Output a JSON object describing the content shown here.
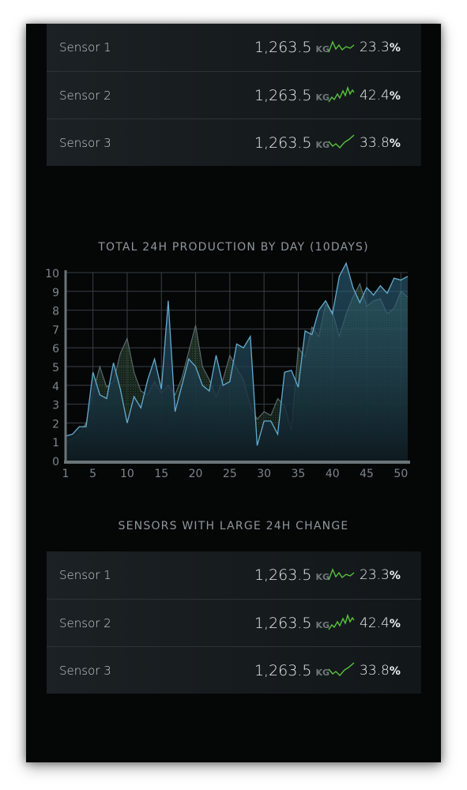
{
  "units": "KG",
  "top_sensors": [
    {
      "name": "Sensor 1",
      "value": "1,263.5",
      "pct": "23.3",
      "trend": "volatile"
    },
    {
      "name": "Sensor 2",
      "value": "1,263.5",
      "pct": "42.4",
      "trend": "spiky"
    },
    {
      "name": "Sensor 3",
      "value": "1,263.5",
      "pct": "33.8",
      "trend": "rising"
    }
  ],
  "chart_heading": "TOTAL 24H PRODUCTION BY DAY (10DAYS)",
  "chart_data": {
    "type": "area",
    "title": "TOTAL 24H PRODUCTION BY DAY (10DAYS)",
    "x_ticks": [
      1,
      5,
      10,
      15,
      20,
      25,
      30,
      35,
      40,
      45,
      50
    ],
    "y_ticks": [
      0,
      1,
      2,
      3,
      4,
      5,
      6,
      7,
      8,
      9,
      10
    ],
    "xlim": [
      1,
      51
    ],
    "ylim": [
      0,
      10
    ],
    "grid": true,
    "series": [
      {
        "x": [
          1,
          2,
          3,
          4,
          5,
          6,
          7,
          8,
          9,
          10,
          11,
          12,
          13,
          14,
          15,
          16,
          17,
          18,
          19,
          20,
          21,
          22,
          23,
          24,
          25,
          26,
          27,
          28,
          29,
          30,
          31,
          32,
          33,
          34,
          35,
          36,
          37,
          38,
          39,
          40,
          41,
          42,
          43,
          44,
          45,
          46,
          47,
          48,
          49,
          50,
          51
        ],
        "y": [
          1.3,
          1.4,
          1.8,
          1.8,
          4.7,
          3.5,
          3.3,
          5.2,
          3.8,
          2.0,
          3.4,
          2.8,
          4.3,
          5.4,
          3.8,
          8.5,
          2.6,
          4.0,
          5.4,
          5.0,
          4.0,
          3.7,
          5.6,
          4.0,
          4.2,
          6.2,
          6.0,
          6.6,
          0.8,
          2.1,
          2.1,
          1.4,
          4.7,
          4.8,
          3.9,
          6.9,
          6.7,
          8.0,
          8.5,
          7.8,
          9.8,
          10.5,
          9.2,
          8.4,
          9.2,
          8.8,
          9.3,
          8.9,
          9.7,
          9.6,
          9.8
        ]
      },
      {
        "x": [
          1,
          2,
          3,
          4,
          5,
          6,
          7,
          8,
          9,
          10,
          11,
          12,
          13,
          14,
          15,
          16,
          17,
          18,
          19,
          20,
          21,
          22,
          23,
          24,
          25,
          26,
          27,
          28,
          29,
          30,
          31,
          32,
          33,
          34,
          35,
          36,
          37,
          38,
          39,
          40,
          41,
          42,
          43,
          44,
          45,
          46,
          47,
          48,
          49,
          50,
          51
        ],
        "y": [
          0.9,
          1.2,
          1.4,
          2.0,
          3.6,
          5.0,
          3.9,
          4.2,
          5.7,
          6.5,
          4.7,
          3.7,
          3.5,
          4.2,
          3.6,
          4.0,
          3.5,
          4.4,
          5.8,
          7.2,
          5.0,
          4.3,
          3.4,
          4.3,
          5.6,
          4.9,
          4.3,
          2.9,
          2.2,
          2.6,
          2.4,
          3.3,
          2.9,
          1.6,
          6.0,
          5.5,
          7.1,
          6.6,
          8.3,
          7.9,
          6.6,
          7.8,
          8.7,
          9.4,
          8.2,
          8.5,
          8.6,
          7.8,
          8.1,
          9.0,
          8.7
        ]
      }
    ]
  },
  "large_change_heading": "SENSORS WITH LARGE 24H CHANGE",
  "bottom_sensors": [
    {
      "name": "Sensor 1",
      "value": "1,263.5",
      "pct": "23.3",
      "trend": "volatile"
    },
    {
      "name": "Sensor 2",
      "value": "1,263.5",
      "pct": "42.4",
      "trend": "spiky"
    },
    {
      "name": "Sensor 3",
      "value": "1,263.5",
      "pct": "33.8",
      "trend": "rising"
    }
  ],
  "colors": {
    "accent_line": "#5fa9cc",
    "secondary_line": "#5a6a70",
    "spark_green": "#58c43c",
    "grid": "#3a4246"
  },
  "icons": {
    "trend": "sparkline-icon"
  }
}
